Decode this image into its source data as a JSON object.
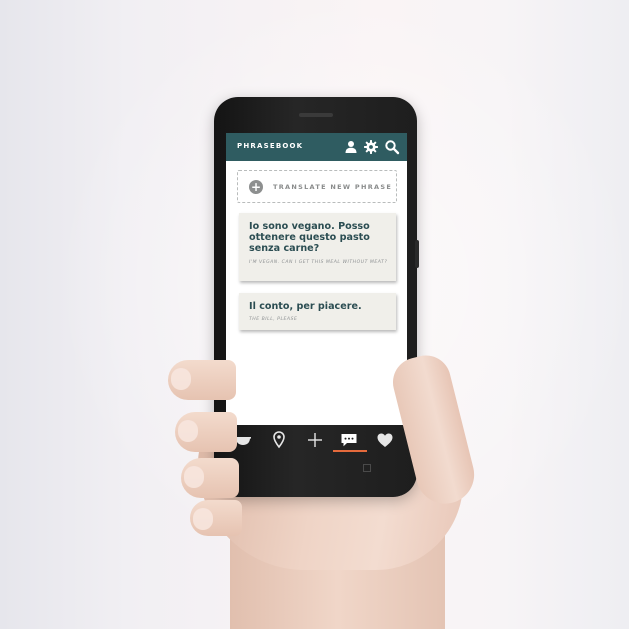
{
  "app": {
    "title": "PHRASEBOOK"
  },
  "header_icons": [
    "user-icon",
    "gear-icon",
    "search-icon"
  ],
  "translate_button": {
    "icon": "plus-circle-icon",
    "label": "TRANSLATE NEW PHRASE"
  },
  "phrases": [
    {
      "phrase": "Io sono vegano. Posso ottenere questo pasto senza carne?",
      "translation": "I'M VEGAN. CAN I GET THIS MEAL WITHOUT MEAT?"
    },
    {
      "phrase": "Il conto, per piacere.",
      "translation": "THE BILL, PLEASE"
    }
  ],
  "bottom_nav": {
    "items": [
      "bowl-icon",
      "location-pin-icon",
      "add-icon",
      "speech-bubble-icon",
      "heart-icon"
    ],
    "active": "speech-bubble-icon"
  },
  "colors": {
    "appbar": "#2f5c61",
    "accent": "#e56a3c",
    "phrase_text": "#2b4d52",
    "card_bg": "#f0efea"
  }
}
